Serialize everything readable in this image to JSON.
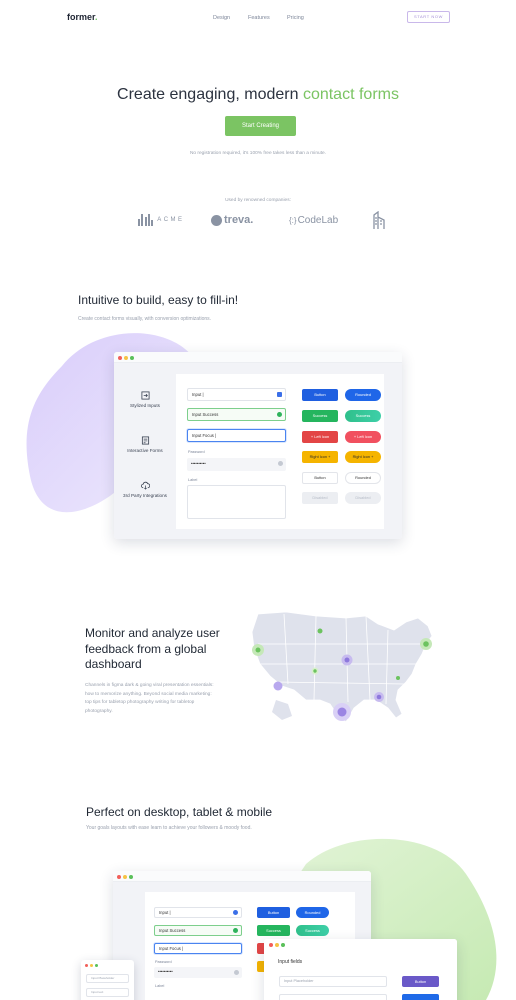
{
  "nav": {
    "logo": "former",
    "logo_dot": ".",
    "links": [
      "Design",
      "Features",
      "Pricing"
    ],
    "cta": "START NOW"
  },
  "hero": {
    "title_start": "Create engaging, modern ",
    "title_accent": "contact forms",
    "cta": "Start Creating",
    "note": "No registration required, it's 100% free takes less than a minute.",
    "used_by": "Used by renowned companies:"
  },
  "companies": {
    "acme": "ACME",
    "treva": "treva.",
    "codelab_brace": "{:}",
    "codelab": "CodeLab"
  },
  "section_build": {
    "title": "Intuitive to build, easy to fill-in!",
    "subtitle": "Create contact forms visually, with conversion optimizations.",
    "sidebar": [
      {
        "label": "Stylized Inputs",
        "icon": "enter-icon"
      },
      {
        "label": "Interactive Forms",
        "icon": "form-icon"
      },
      {
        "label": "3rd Party Integrations",
        "icon": "cloud-icon"
      }
    ],
    "form": {
      "input_value": "Input |",
      "input_success": "Input Success",
      "input_focus": "Input Focus |",
      "password_label": "Password",
      "password_value": "••••••••••",
      "label_label": "Label"
    },
    "buttons": [
      [
        "Button",
        "Rounded"
      ],
      [
        "Success",
        "Success"
      ],
      [
        "+ Left Icon",
        "+ Left Icon"
      ],
      [
        "Right Icon +",
        "Right Icon +"
      ],
      [
        "Button",
        "Rounded"
      ],
      [
        "Disabled",
        "Disabled"
      ]
    ]
  },
  "section_monitor": {
    "title": "Monitor and analyze user feedback from a global dashboard",
    "body": "Channels in figma dark & going viral presentation essentials: how to memorize anything. Beyond social media marketing: top tips for tabletop photography writing for tabletop photography."
  },
  "section_devices": {
    "title": "Perfect on desktop, tablet & mobile",
    "subtitle": "Your goals layouts with ease learn to achieve your followers & moody food.",
    "form": {
      "input_value": "Input |",
      "input_success": "Input Success",
      "input_focus": "Input Focus |",
      "password_label": "Password",
      "password_value": "••••••••••",
      "label_label": "Label"
    },
    "buttons": [
      [
        "Button",
        "Rounded"
      ],
      [
        "Success",
        "Success"
      ],
      [
        "Left Icon"
      ]
    ],
    "tablet": {
      "title": "Input fields",
      "placeholder": "Input Placeholder",
      "button": "Button"
    },
    "mobile": {
      "placeholder": "Input Placeholder",
      "field2": "Input text"
    }
  },
  "colors": {
    "accent_green": "#7bc463",
    "accent_purple": "#a48fd6",
    "primary_blue": "#1f5fe0"
  }
}
